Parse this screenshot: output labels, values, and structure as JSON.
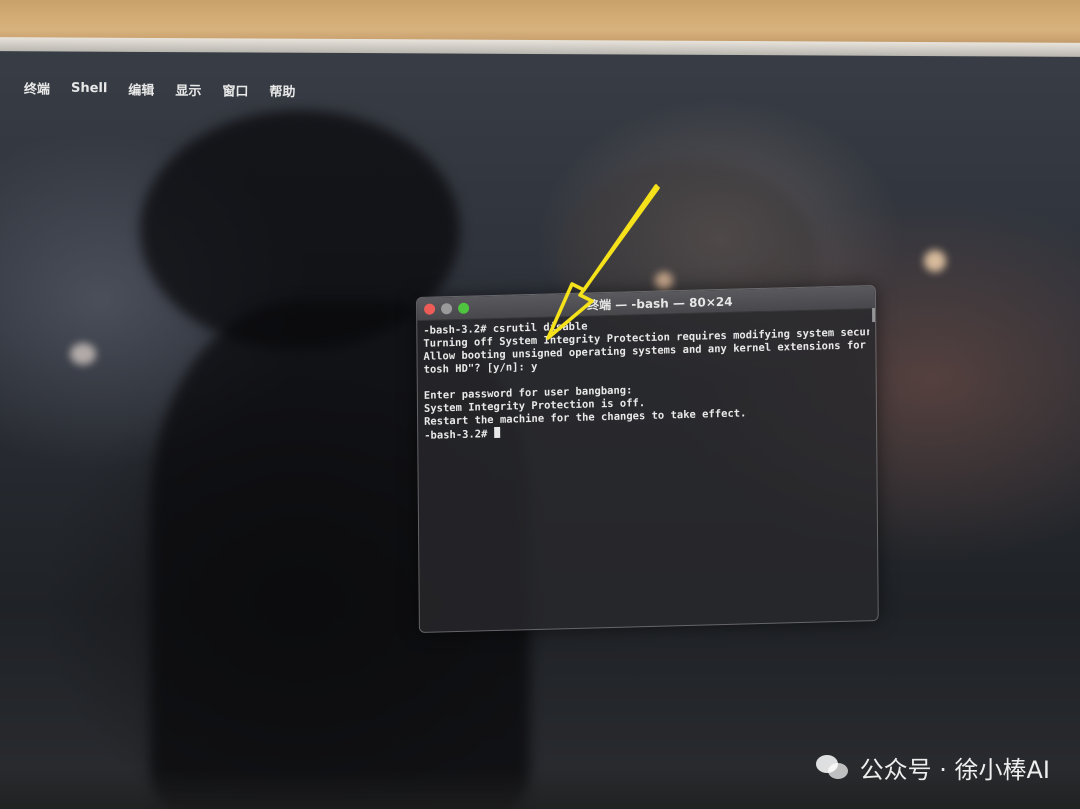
{
  "menubar": {
    "items": [
      "终端",
      "Shell",
      "编辑",
      "显示",
      "窗口",
      "帮助"
    ]
  },
  "terminal": {
    "title": "终端 — -bash — 80×24",
    "lines": [
      "-bash-3.2# csrutil disable",
      "Turning off System Integrity Protection requires modifying system security.",
      "Allow booting unsigned operating systems and any kernel extensions for OS \"Macin",
      "tosh HD\"? [y/n]: y",
      "",
      "Enter password for user bangbang:",
      "System Integrity Protection is off.",
      "Restart the machine for the changes to take effect.",
      "-bash-3.2# "
    ]
  },
  "watermark": {
    "text": "公众号 · 徐小棒AI",
    "icon": "wechat-icon"
  },
  "annotation": {
    "arrow_color": "#f5e21a"
  }
}
